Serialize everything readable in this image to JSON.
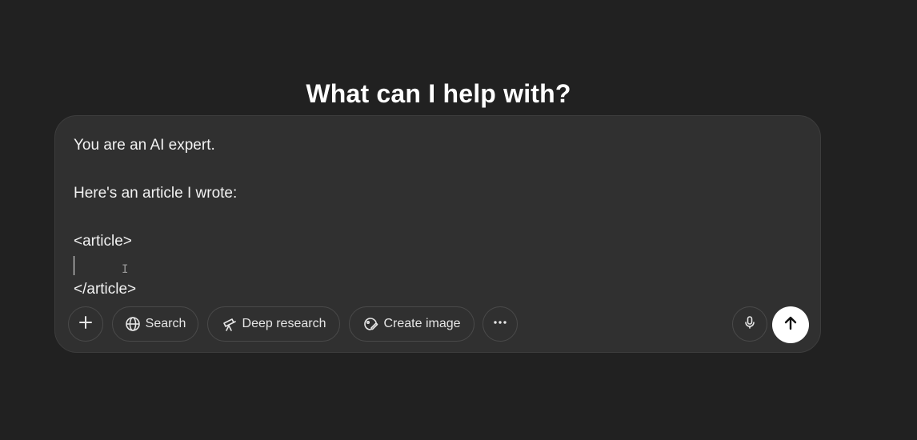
{
  "page": {
    "heading": "What can I help with?"
  },
  "composer": {
    "lines": [
      "You are an AI expert.",
      "",
      "Here's an article I wrote:",
      "",
      "<article>",
      "",
      "</article>"
    ],
    "tools": {
      "search_label": "Search",
      "deep_research_label": "Deep research",
      "create_image_label": "Create image"
    },
    "icons": {
      "add": "plus-icon",
      "search": "globe-icon",
      "deep_research": "telescope-icon",
      "create_image": "image-brush-icon",
      "more": "more-icon",
      "voice": "microphone-icon",
      "send": "arrow-up-icon"
    }
  },
  "colors": {
    "background": "#212121",
    "composer": "#303030",
    "send_button": "#ffffff"
  }
}
